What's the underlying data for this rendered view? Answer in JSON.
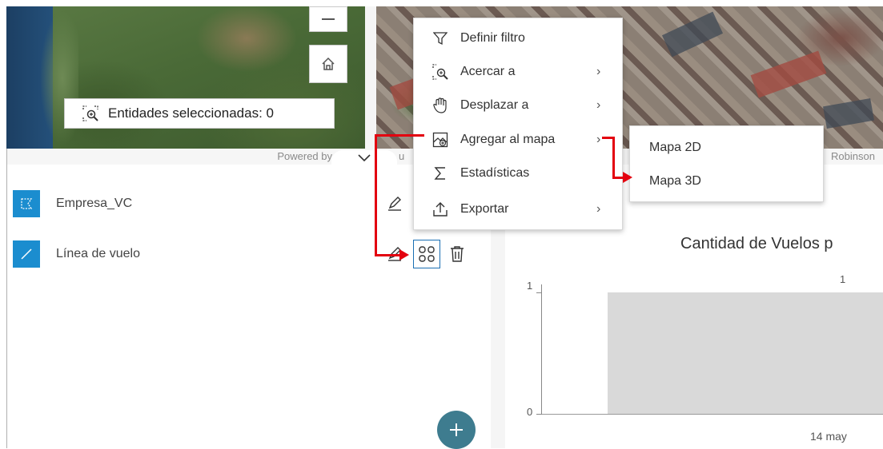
{
  "map": {
    "selection_badge_text": "Entidades seleccionadas: 0",
    "attribution_left": "Powered by",
    "attribution_mid": "u",
    "attribution_right": "Robinson"
  },
  "layers": [
    {
      "label": "Empresa_VC",
      "icon": "polygon-layer-icon"
    },
    {
      "label": "Línea de vuelo",
      "icon": "polyline-layer-icon"
    }
  ],
  "context_menu": {
    "items": [
      {
        "label": "Definir filtro",
        "icon": "filter-icon",
        "has_submenu": false
      },
      {
        "label": "Acercar a",
        "icon": "zoom-to-icon",
        "has_submenu": true
      },
      {
        "label": "Desplazar a",
        "icon": "pan-hand-icon",
        "has_submenu": true
      },
      {
        "label": "Agregar al mapa",
        "icon": "add-to-map-icon",
        "has_submenu": true
      },
      {
        "label": "Estadísticas",
        "icon": "sigma-icon",
        "has_submenu": false
      },
      {
        "label": "Exportar",
        "icon": "export-icon",
        "has_submenu": true
      }
    ],
    "chevron": "›"
  },
  "submenu": {
    "items": [
      "Mapa 2D",
      "Mapa 3D"
    ]
  },
  "chart_data": {
    "type": "bar",
    "title": "Cantidad de Vuelos p",
    "categories": [
      "14 may"
    ],
    "values": [
      1
    ],
    "data_labels": [
      "1"
    ],
    "y_ticks": [
      "1",
      "0"
    ],
    "ylim": [
      0,
      1
    ]
  },
  "colors": {
    "accent": "#1b8dcf",
    "annotation_red": "#e3000f",
    "fab": "#3e7c8f",
    "bar": "#d9d9d9"
  }
}
